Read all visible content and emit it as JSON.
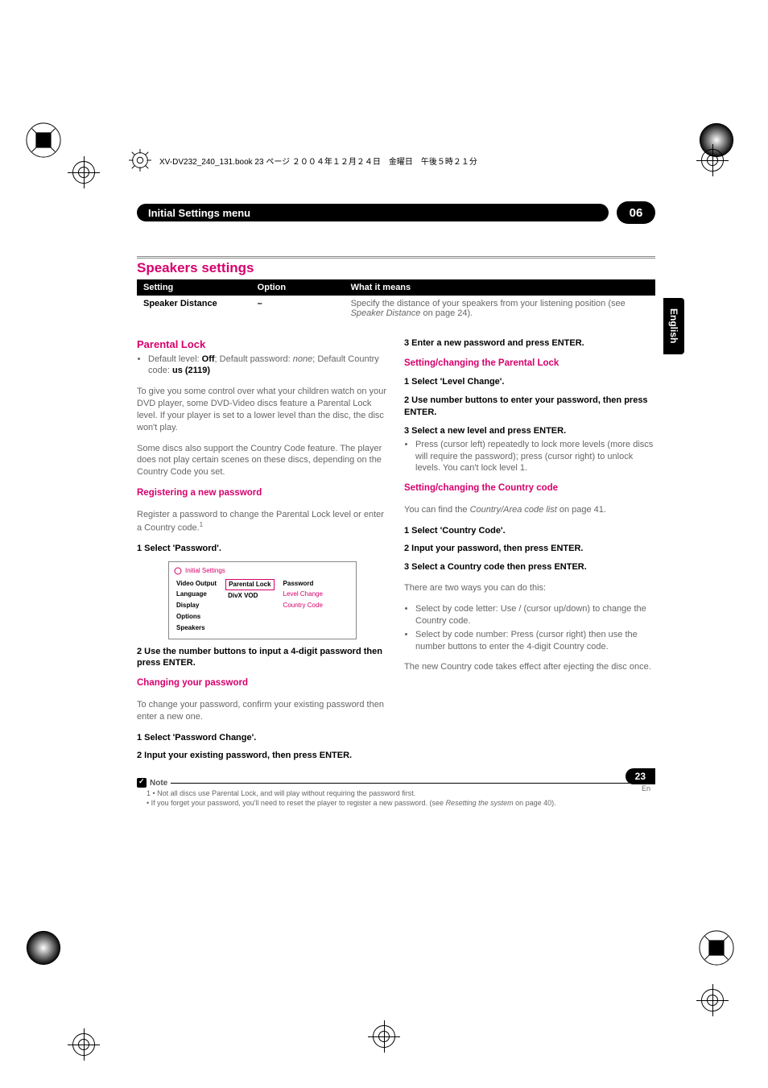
{
  "bookline": "XV-DV232_240_131.book 23 ページ ２００４年１２月２４日　金曜日　午後５時２１分",
  "header": {
    "title": "Initial Settings menu",
    "chapter": "06"
  },
  "side_tab": "English",
  "section_title": "Speakers settings",
  "table": {
    "headers": {
      "c1": "Setting",
      "c2": "Option",
      "c3": "What it means"
    },
    "row": {
      "c1": "Speaker Distance",
      "c2": "–",
      "c3_a": "Specify the distance of your speakers from your listening position (see ",
      "c3_i": "Speaker Distance",
      "c3_b": " on page 24)."
    }
  },
  "left": {
    "h3": "Parental Lock",
    "bullet1_a": "Default level: ",
    "bullet1_b": "Off",
    "bullet1_c": "; Default password: ",
    "bullet1_d": "none",
    "bullet1_e": "; Default Country code: ",
    "bullet1_f": "us (2119)",
    "p1": "To give you some control over what your children watch on your DVD player, some DVD-Video discs feature a Parental Lock level. If your player is set to a lower level than the disc, the disc won't play.",
    "p2": "Some discs also support the Country Code feature. The player does not play certain scenes on these discs, depending on the Country Code you set.",
    "h4a": "Registering a new password",
    "p3a": "Register a password to change the Parental Lock level or enter a Country code.",
    "sup1": "1",
    "step1": "1    Select 'Password'.",
    "ss": {
      "title": "Initial Settings",
      "col1": [
        "Video Output",
        "Language",
        "Display",
        "Options",
        "Speakers"
      ],
      "col2": [
        "Parental Lock",
        "DivX VOD"
      ],
      "col3": [
        "Password",
        "Level Change",
        "Country Code"
      ]
    },
    "step2": "2    Use the number buttons to input a 4-digit password then press ENTER.",
    "h4b": "Changing your password",
    "p4": "To change your password, confirm your existing password then enter a new one.",
    "step3": "1    Select 'Password Change'.",
    "step4": "2    Input your existing password, then press ENTER."
  },
  "right": {
    "step1": "3    Enter a new password and press ENTER.",
    "h4a": "Setting/changing the Parental Lock",
    "step2": "1    Select 'Level Change'.",
    "step3": "2    Use number buttons to enter your password, then press ENTER.",
    "step4": "3    Select a new level and press ENTER.",
    "bullet1": "Press  (cursor left) repeatedly to lock more levels (more discs will require the password); press  (cursor right) to unlock levels. You can't lock level 1.",
    "h4b": "Setting/changing the Country code",
    "p1a": "You can find the ",
    "p1i": "Country/Area code list",
    "p1b": " on page 41.",
    "step5": "1    Select 'Country Code'.",
    "step6": "2    Input your password, then press ENTER.",
    "step7": "3    Select a Country code then press ENTER.",
    "p2": "There are two ways you can do this:",
    "bullet2": "Select by code letter: Use / (cursor up/down) to change the Country code.",
    "bullet3": "Select by code number: Press  (cursor right) then use the number buttons to enter the 4-digit Country code.",
    "p3": "The new Country code takes effect after ejecting the disc once."
  },
  "note": {
    "label": "Note",
    "l1": "1 • Not all discs use Parental Lock, and will play without requiring the password first.",
    "l2a": "• If you forget your password, you'll need to reset the player to register a new password. (see ",
    "l2i": "Resetting the system",
    "l2b": " on page 40)."
  },
  "footer": {
    "page": "23",
    "lang": "En"
  }
}
